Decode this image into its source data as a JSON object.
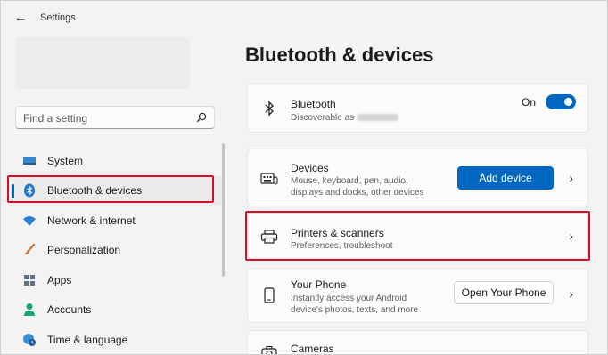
{
  "app": {
    "title": "Settings",
    "back_icon": "back-arrow-icon"
  },
  "search": {
    "placeholder": "Find a setting",
    "icon": "search-icon"
  },
  "sidebar": {
    "items": [
      {
        "label": "System",
        "icon": "system-icon",
        "active": false
      },
      {
        "label": "Bluetooth & devices",
        "icon": "bluetooth-icon",
        "active": true
      },
      {
        "label": "Network & internet",
        "icon": "wifi-icon",
        "active": false
      },
      {
        "label": "Personalization",
        "icon": "brush-icon",
        "active": false
      },
      {
        "label": "Apps",
        "icon": "apps-icon",
        "active": false
      },
      {
        "label": "Accounts",
        "icon": "person-icon",
        "active": false
      },
      {
        "label": "Time & language",
        "icon": "globe-clock-icon",
        "active": false
      }
    ]
  },
  "main": {
    "title": "Bluetooth & devices",
    "bluetooth": {
      "title": "Bluetooth",
      "subtitle": "Discoverable as",
      "toggle_label": "On",
      "toggle_on": true
    },
    "devices": {
      "title": "Devices",
      "subtitle_line1": "Mouse, keyboard, pen, audio,",
      "subtitle_line2": "displays and docks, other devices",
      "button": "Add device"
    },
    "printers": {
      "title": "Printers & scanners",
      "subtitle": "Preferences, troubleshoot"
    },
    "phone": {
      "title": "Your Phone",
      "subtitle_line1": "Instantly access your Android",
      "subtitle_line2": "device's photos, texts, and more",
      "button": "Open Your Phone"
    },
    "cameras": {
      "title": "Cameras"
    }
  },
  "colors": {
    "accent": "#0067c0",
    "highlight_box": "#d20f26",
    "background": "#f3f3f3",
    "card": "#fbfbfb"
  }
}
